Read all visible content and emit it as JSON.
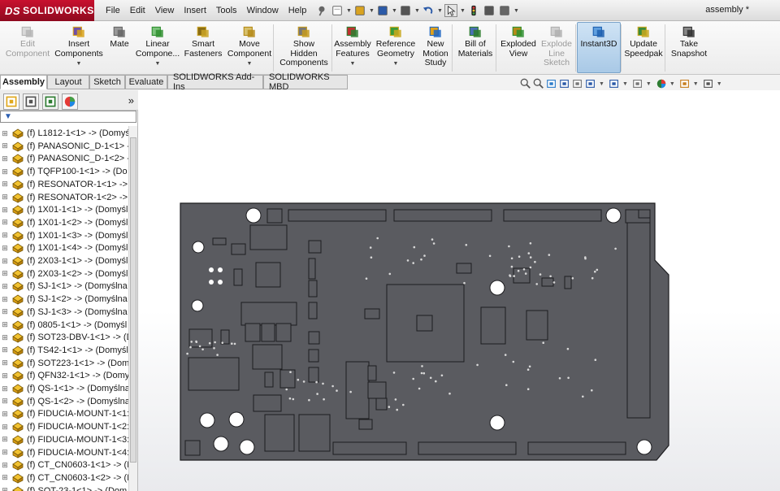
{
  "app": {
    "brand": "SOLIDWORKS",
    "brand_prefix": "DS",
    "document_title": "assembly *",
    "accent": "#c8102e"
  },
  "menu": [
    "File",
    "Edit",
    "View",
    "Insert",
    "Tools",
    "Window",
    "Help"
  ],
  "quick_access": [
    "pin-icon",
    "new-document-icon",
    "open-icon",
    "save-icon",
    "print-icon",
    "undo-icon",
    "select-icon",
    "rebuild-icon",
    "file-properties-icon",
    "options-icon"
  ],
  "commands": [
    {
      "label": "Edit\nComponent",
      "icon": "edit-component-icon",
      "enabled": false,
      "dropdown": false
    },
    {
      "label": "Insert\nComponents",
      "icon": "insert-components-icon",
      "enabled": true,
      "dropdown": true
    },
    {
      "label": "Mate",
      "icon": "mate-icon",
      "enabled": true,
      "dropdown": false
    },
    {
      "label": "Linear\nCompone...",
      "icon": "linear-pattern-icon",
      "enabled": true,
      "dropdown": true
    },
    {
      "label": "Smart\nFasteners",
      "icon": "smart-fasteners-icon",
      "enabled": true,
      "dropdown": false
    },
    {
      "label": "Move\nComponent",
      "icon": "move-component-icon",
      "enabled": true,
      "dropdown": true
    },
    {
      "label": "Show\nHidden\nComponents",
      "icon": "show-hidden-icon",
      "enabled": true,
      "dropdown": false
    },
    {
      "label": "Assembly\nFeatures",
      "icon": "assembly-features-icon",
      "enabled": true,
      "dropdown": true
    },
    {
      "label": "Reference\nGeometry",
      "icon": "reference-geometry-icon",
      "enabled": true,
      "dropdown": true
    },
    {
      "label": "New\nMotion\nStudy",
      "icon": "motion-study-icon",
      "enabled": true,
      "dropdown": false
    },
    {
      "label": "Bill of\nMaterials",
      "icon": "bill-of-materials-icon",
      "enabled": true,
      "dropdown": false
    },
    {
      "label": "Exploded\nView",
      "icon": "exploded-view-icon",
      "enabled": true,
      "dropdown": false
    },
    {
      "label": "Explode\nLine\nSketch",
      "icon": "explode-line-sketch-icon",
      "enabled": false,
      "dropdown": false
    },
    {
      "label": "Instant3D",
      "icon": "instant3d-icon",
      "enabled": true,
      "dropdown": false,
      "active": true
    },
    {
      "label": "Update\nSpeedpak",
      "icon": "update-speedpak-icon",
      "enabled": true,
      "dropdown": false
    },
    {
      "label": "Take\nSnapshot",
      "icon": "take-snapshot-icon",
      "enabled": true,
      "dropdown": false
    }
  ],
  "tabs": [
    "Assembly",
    "Layout",
    "Sketch",
    "Evaluate",
    "SOLIDWORKS Add-Ins",
    "SOLIDWORKS MBD"
  ],
  "active_tab": "Assembly",
  "view_tools": [
    "zoom-to-fit-icon",
    "zoom-to-area-icon",
    "previous-view-icon",
    "section-view-icon",
    "dynamic-annotation-icon",
    "view-orientation-icon",
    "display-style-icon",
    "hide-show-items-icon",
    "edit-appearance-icon",
    "apply-scene-icon",
    "view-settings-icon"
  ],
  "feature_tree": {
    "panel_tabs": [
      "featuremanager-icon",
      "propertymanager-icon",
      "configurationmanager-icon",
      "displaymanager-icon"
    ],
    "collapse_label": "»",
    "filter_icon": "filter-icon",
    "items": [
      "(f) L1812-1<1> -> (Domyś",
      "(f) PANASONIC_D-1<1> -",
      "(f) PANASONIC_D-1<2> -",
      "(f) TQFP100-1<1> -> (Do",
      "(f) RESONATOR-1<1> ->",
      "(f) RESONATOR-1<2> ->",
      "(f) 1X01-1<1> -> (Domyśl",
      "(f) 1X01-1<2> -> (Domyśl",
      "(f) 1X01-1<3> -> (Domyśl",
      "(f) 1X01-1<4> -> (Domyśl",
      "(f) 2X03-1<1> -> (Domyśl",
      "(f) 2X03-1<2> -> (Domyśl",
      "(f) SJ-1<1> -> (Domyślna",
      "(f) SJ-1<2> -> (Domyślna",
      "(f) SJ-1<3> -> (Domyślna",
      "(f) 0805-1<1> -> (Domyśl",
      "(f) SOT23-DBV-1<1> -> (D",
      "(f) TS42-1<1> -> (Domyśl",
      "(f) SOT223-1<1> -> (Dom",
      "(f) QFN32-1<1> -> (Domy",
      "(f) QS-1<1> -> (Domyślna",
      "(f) QS-1<2> -> (Domyślna",
      "(f) FIDUCIA-MOUNT-1<1:",
      "(f) FIDUCIA-MOUNT-1<2:",
      "(f) FIDUCIA-MOUNT-1<3:",
      "(f) FIDUCIA-MOUNT-1<4:",
      "(f) CT_CN0603-1<1> -> (I",
      "(f) CT_CN0603-1<2> -> (I",
      "(f) SOT-23-1<1> -> (Dom"
    ]
  },
  "model": {
    "board_color": "#5a5b60",
    "edge_color": "#1c1c1f",
    "pad_color": "#ffffff"
  }
}
